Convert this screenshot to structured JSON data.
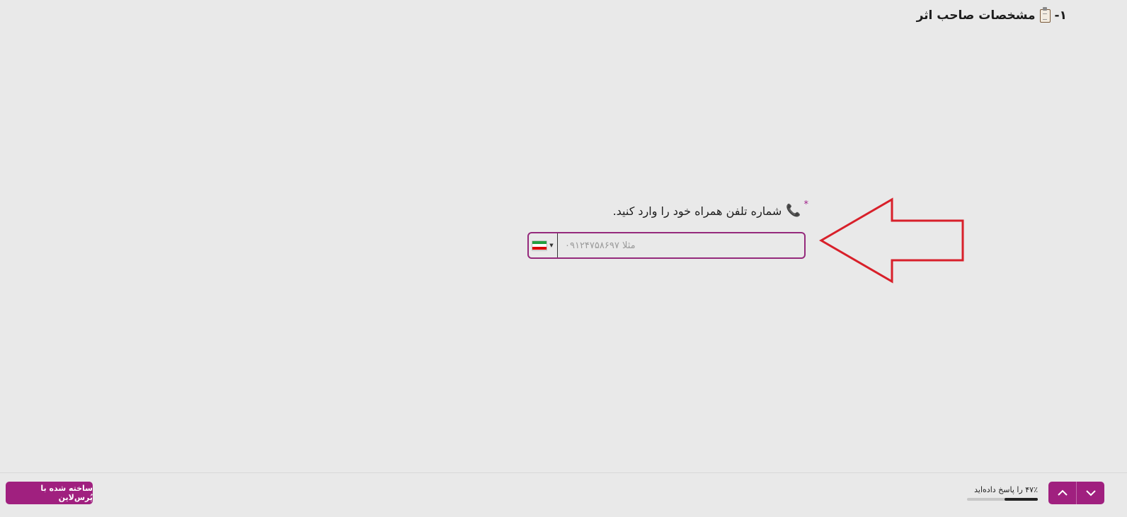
{
  "section": {
    "number": "۱-",
    "title": "مشخصات صاحب اثر",
    "icon": "clipboard-icon"
  },
  "question": {
    "label": "شماره تلفن همراه خود را وارد کنید.",
    "required_mark": "*",
    "icon": "phone-icon",
    "placeholder": "مثلا ۰۹۱۲۴۷۵۸۶۹۷",
    "value": "",
    "country": "Iran",
    "flag_colors": [
      "#239f40",
      "#ffffff",
      "#da0000"
    ]
  },
  "footer": {
    "brand_label": "ساخته شده با پُرس‌لاین",
    "progress_text": "۴۷٪ را پاسخ داده‌اید",
    "progress": 0.47,
    "accent": "#a0207f"
  }
}
